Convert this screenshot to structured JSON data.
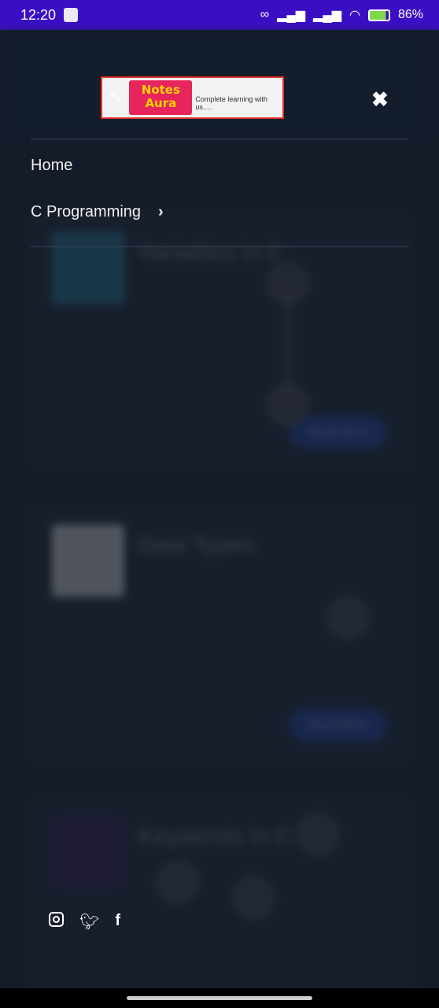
{
  "status_bar": {
    "time": "12:20",
    "battery": "86%"
  },
  "background": {
    "posts": [
      "Variables in C",
      "Data Types",
      "Keywords in C"
    ],
    "read_more": "Read More"
  },
  "logo": {
    "line1": "Notes",
    "line2": "Aura",
    "tagline": "Complete learning with us....."
  },
  "menu": {
    "items": [
      {
        "label": "Home"
      },
      {
        "label": "C Programming",
        "has_submenu": true
      }
    ]
  },
  "social": [
    "instagram-icon",
    "twitter-icon",
    "facebook-icon"
  ],
  "colors": {
    "status_bar": "#3a0fc4",
    "background": "#1a2231",
    "logo_badge": "#e8245c",
    "logo_text": "#ffd200"
  }
}
